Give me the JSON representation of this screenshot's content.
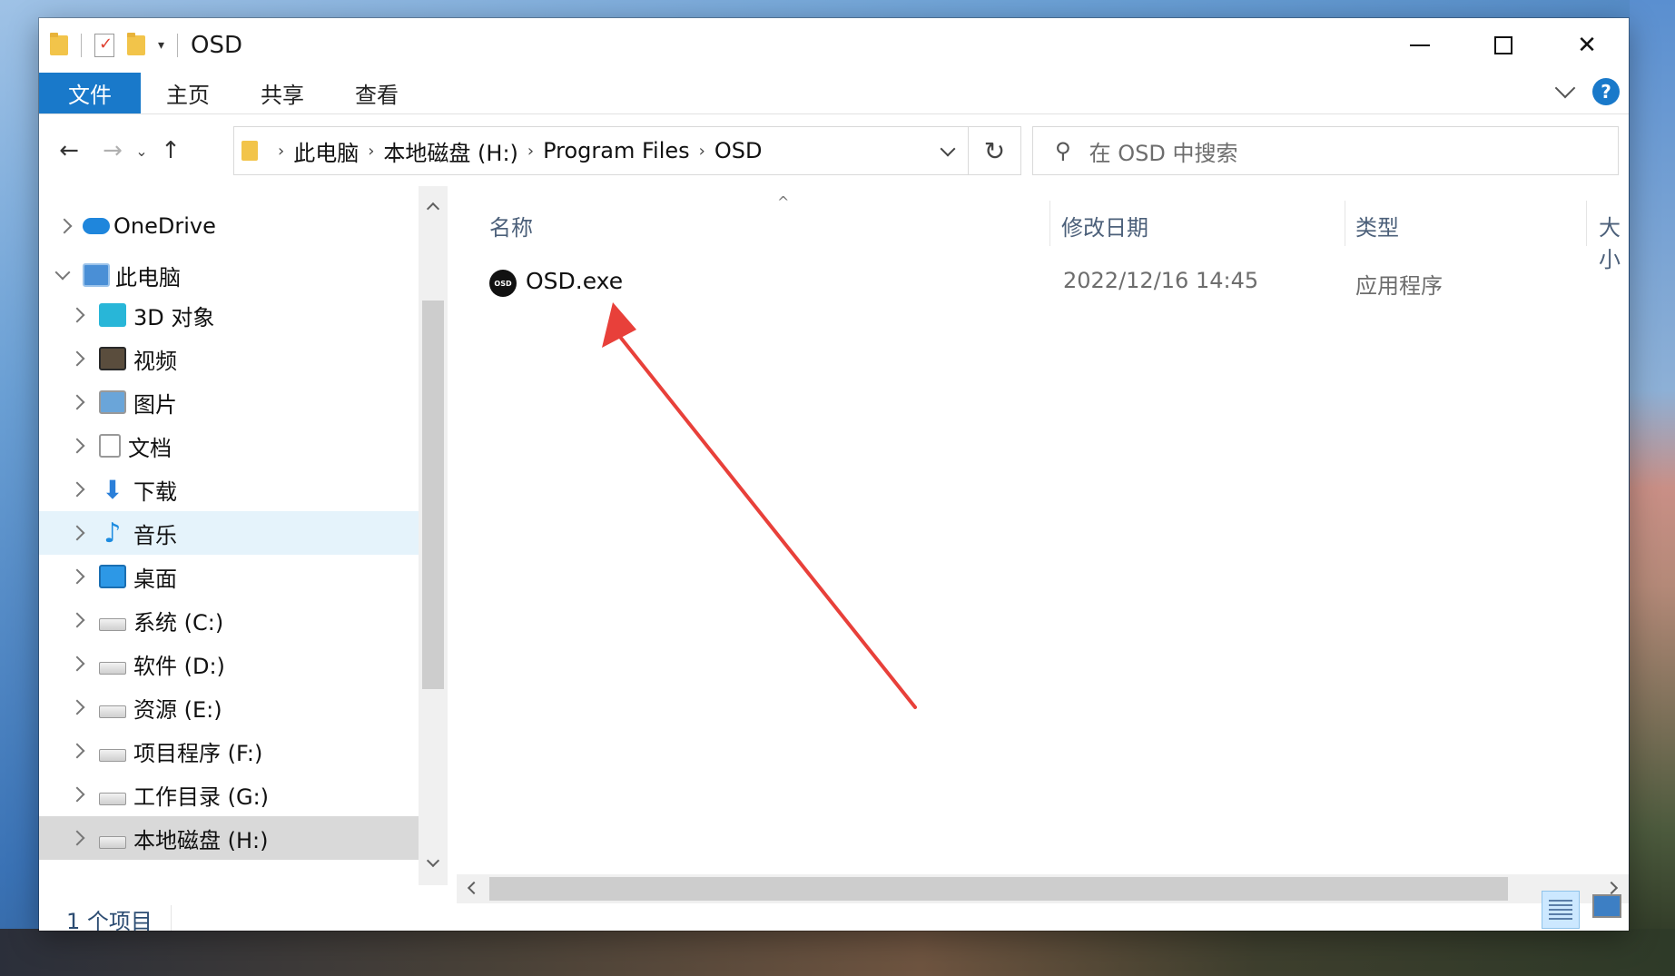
{
  "window": {
    "title": "OSD"
  },
  "ribbon": {
    "tabs": [
      "文件",
      "主页",
      "共享",
      "查看"
    ],
    "help": "?"
  },
  "nav": {
    "breadcrumbs": [
      "此电脑",
      "本地磁盘 (H:)",
      "Program Files",
      "OSD"
    ],
    "search_placeholder": "在 OSD 中搜索"
  },
  "sidebar": {
    "items": [
      {
        "label": "OneDrive",
        "icon": "onedrive-cloud-icon"
      },
      {
        "label": "此电脑",
        "icon": "this-pc-icon"
      },
      {
        "label": "3D 对象",
        "icon": "3d-objects-icon"
      },
      {
        "label": "视频",
        "icon": "videos-icon"
      },
      {
        "label": "图片",
        "icon": "pictures-icon"
      },
      {
        "label": "文档",
        "icon": "documents-icon"
      },
      {
        "label": "下载",
        "icon": "downloads-icon"
      },
      {
        "label": "音乐",
        "icon": "music-icon"
      },
      {
        "label": "桌面",
        "icon": "desktop-icon"
      },
      {
        "label": "系统 (C:)",
        "icon": "drive-icon"
      },
      {
        "label": "软件 (D:)",
        "icon": "drive-icon"
      },
      {
        "label": "资源 (E:)",
        "icon": "drive-icon"
      },
      {
        "label": "项目程序 (F:)",
        "icon": "drive-icon"
      },
      {
        "label": "工作目录 (G:)",
        "icon": "drive-icon"
      },
      {
        "label": "本地磁盘 (H:)",
        "icon": "drive-icon"
      }
    ]
  },
  "list": {
    "columns": [
      "名称",
      "修改日期",
      "类型",
      "大小"
    ],
    "rows": [
      {
        "name": "OSD.exe",
        "modified": "2022/12/16 14:45",
        "type": "应用程序",
        "icon_text": "OSD"
      }
    ]
  },
  "status": {
    "count": "1 个项目"
  },
  "colors": {
    "accent": "#1979ca",
    "arrow": "#e8403a",
    "selection": "#e5f3fb"
  }
}
